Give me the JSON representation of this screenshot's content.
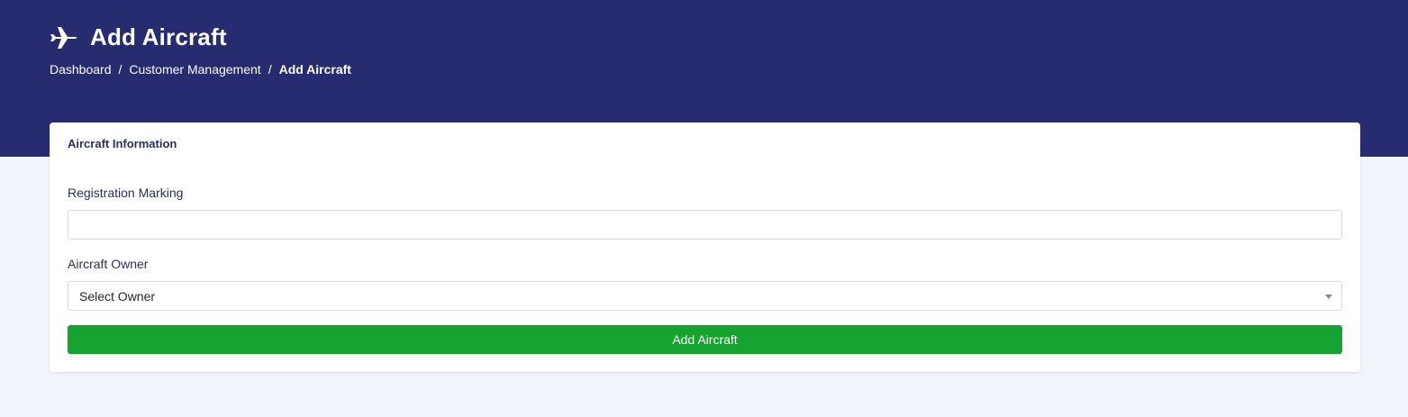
{
  "header": {
    "title": "Add Aircraft",
    "icon": "plane-icon",
    "background_color": "#272b6f"
  },
  "breadcrumb": {
    "items": [
      "Dashboard",
      "Customer Management",
      "Add Aircraft"
    ],
    "separator": "/"
  },
  "card": {
    "title": "Aircraft Information"
  },
  "form": {
    "registration_label": "Registration Marking",
    "registration_value": "",
    "owner_label": "Aircraft Owner",
    "owner_selected": "Select Owner",
    "submit_label": "Add Aircraft",
    "submit_color": "#17a32f"
  }
}
